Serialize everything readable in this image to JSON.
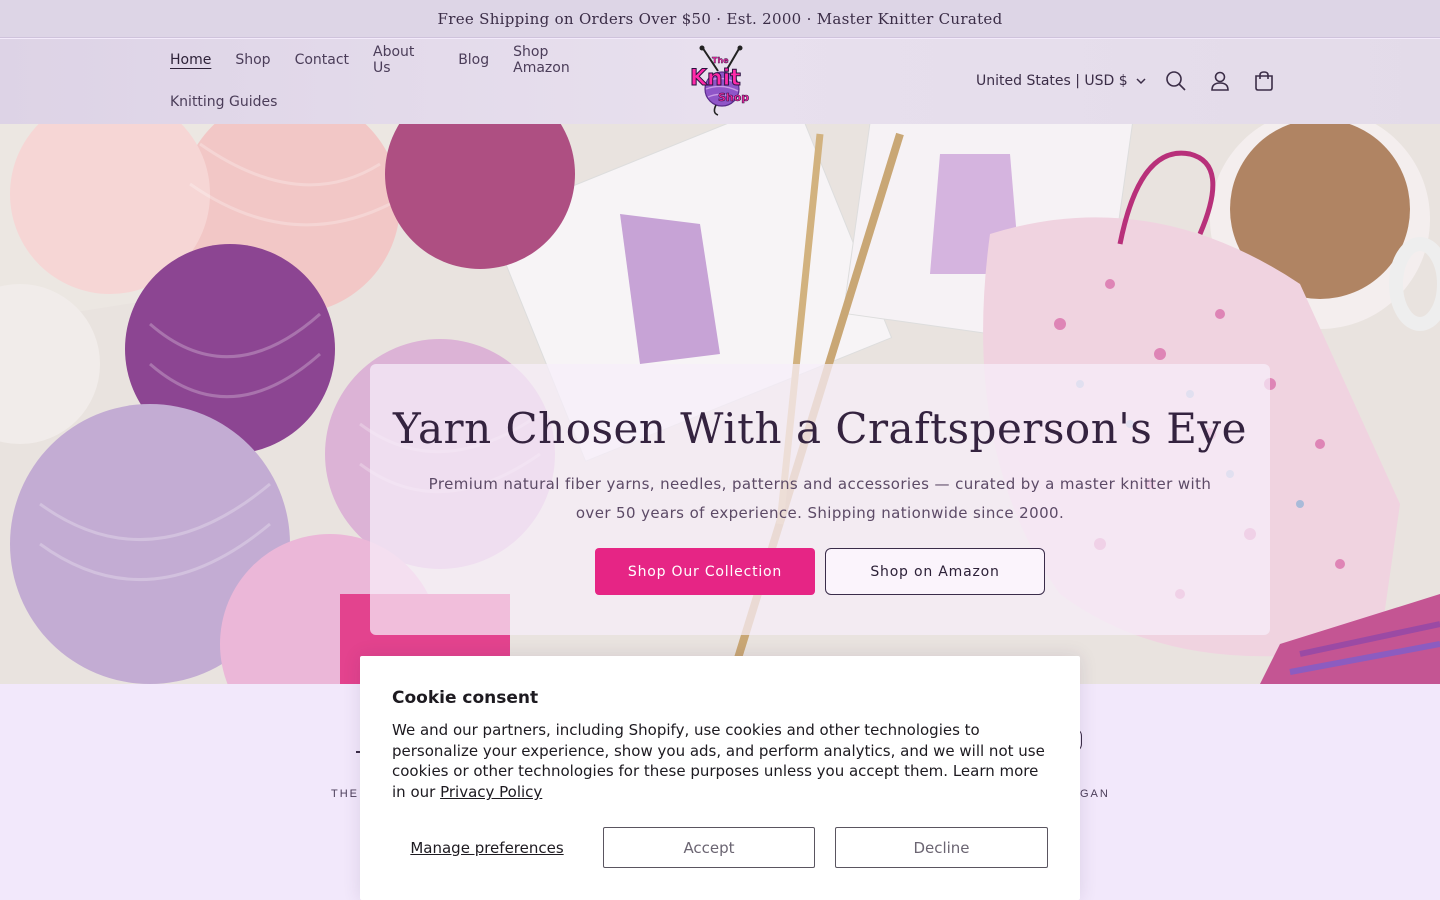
{
  "announcement": {
    "text": "Free Shipping on Orders Over $50 · Est. 2000 · Master Knitter Curated"
  },
  "nav": {
    "items": [
      {
        "label": "Home"
      },
      {
        "label": "Shop"
      },
      {
        "label": "Contact"
      },
      {
        "label": "About Us"
      },
      {
        "label": "Blog"
      },
      {
        "label": "Shop Amazon"
      },
      {
        "label": "Knitting Guides"
      }
    ],
    "active": "Home"
  },
  "logo": {
    "line1": "The",
    "line2": "Knit",
    "line3": "Shop"
  },
  "header": {
    "locale_label": "United States | USD $",
    "icons": [
      "search-icon",
      "account-icon",
      "cart-icon"
    ]
  },
  "hero": {
    "title": "Yarn Chosen With a Craftsperson's Eye",
    "subtitle": "Premium natural fiber yarns, needles, patterns and accessories — curated by a master knitter with over 50 years of experience. Shipping nationwide since 2000.",
    "primary_button": "Shop Our Collection",
    "secondary_button": "Shop on Amazon"
  },
  "lower": {
    "tag_left": "THE",
    "tag_right": "GAN"
  },
  "cookie": {
    "title": "Cookie consent",
    "body": "We and our partners, including Shopify, use cookies and other technologies to personalize your experience, show you ads, and perform analytics, and we will not use cookies or other technologies for these purposes unless you accept them. Learn more in our",
    "link": "Privacy Policy",
    "manage": "Manage preferences",
    "accept": "Accept",
    "decline": "Decline"
  },
  "colors": {
    "accent": "#e62585",
    "announcement_bg": "#ddd5e6",
    "text_dark": "#3b2d47"
  }
}
